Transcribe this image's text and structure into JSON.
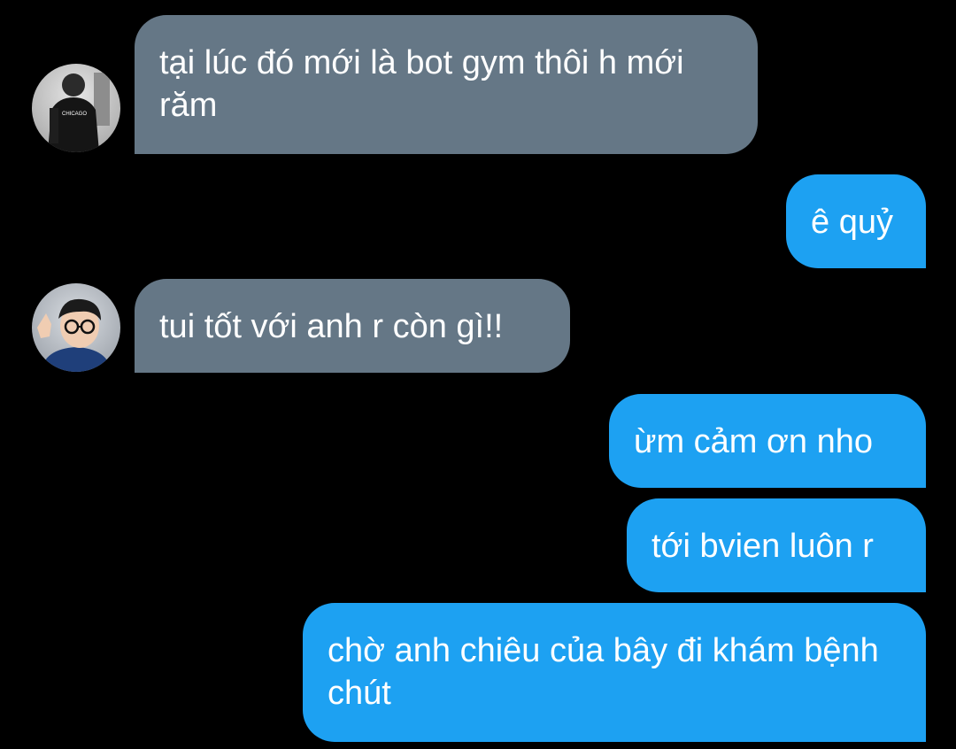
{
  "conversation": {
    "messages": [
      {
        "sender": "them",
        "text": "tại lúc đó mới là bot gym thôi h mới răm",
        "avatar": "person-black-shirt-avatar"
      },
      {
        "sender": "me",
        "text": "ê quỷ"
      },
      {
        "sender": "them",
        "text": "tui tốt với anh r còn gì!!",
        "avatar": "person-glasses-avatar"
      },
      {
        "sender": "me",
        "text": "ừm cảm ơn nho"
      },
      {
        "sender": "me",
        "text": "tới bvien luôn r"
      },
      {
        "sender": "me",
        "text": "chờ anh chiêu của bây đi khám bệnh chút"
      }
    ],
    "avatar_shirt_text": "CHICAGO"
  },
  "colors": {
    "background": "#000000",
    "incoming_bubble": "#657786",
    "outgoing_bubble": "#1da1f2",
    "text": "#ffffff"
  }
}
